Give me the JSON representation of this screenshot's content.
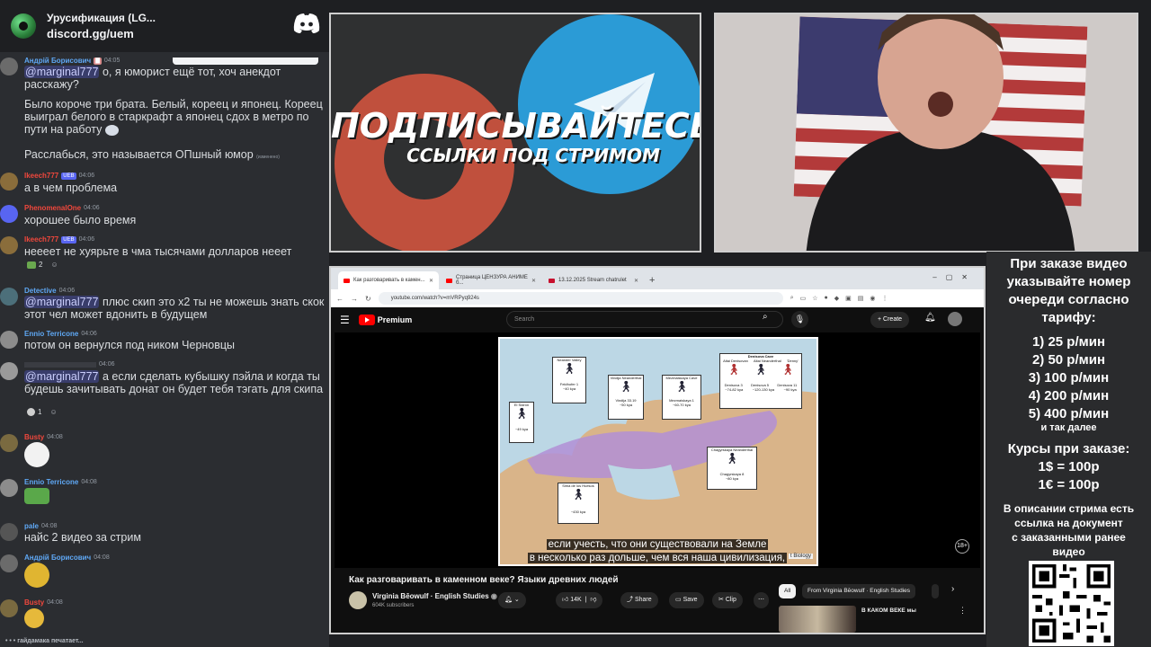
{
  "chat": {
    "server_name": "Урусификация (LG...",
    "invite": "discord.gg/uem",
    "typing": "гайдамака печатает...",
    "messages": [
      {
        "user": "Андрій Борисович",
        "user_color": "#5fa8f5",
        "time": "04:05",
        "mention": "@marginal777",
        "text": "о, я юморист ещё тот, хоч анекдот расскажу?"
      },
      {
        "user": "",
        "text": "Было короче три брата. Белый, кореец и японец. Кореец выиграл белого в старкрафт а японец сдох в метро по пути на работу"
      },
      {
        "user": "",
        "text": "Расслабься, это называется ОПшный юмор",
        "edited": "(изменено)"
      },
      {
        "user": "Ikeech777",
        "user_color": "#f0473c",
        "time": "04:06",
        "badge": "UEB",
        "text": "а в чем проблема"
      },
      {
        "user": "PhenomenalOne",
        "user_color": "#f0473c",
        "time": "04:06",
        "text": "хорошее было время"
      },
      {
        "user": "Ikeech777",
        "user_color": "#f0473c",
        "time": "04:06",
        "badge": "UEB",
        "text": "нееeeт не хуярьте в чма тысячами долларов нееет",
        "reaction_count": "2"
      },
      {
        "user": "Detective",
        "user_color": "#5fa8f5",
        "time": "04:06",
        "mention": "@marginal777",
        "text": "плюс скип это x2 ты не можешь знать скок этот чел может вдонить в будущем"
      },
      {
        "user": "Ennio Terricone",
        "user_color": "#5fa8f5",
        "time": "04:06",
        "text": "потом он вернулся под ником Черновцы"
      },
      {
        "user": "",
        "time": "04:06",
        "mention": "@marginal777",
        "text": "а если сделать кубышку пэйла и когда ты будешь зачитывать донат он будет тебя тэгать для скипа",
        "reaction_count": "1"
      },
      {
        "user": "Busty",
        "user_color": "#f0473c",
        "time": "04:08"
      },
      {
        "user": "Ennio Terricone",
        "user_color": "#5fa8f5",
        "time": "04:08"
      },
      {
        "user": "pale",
        "user_color": "#5fa8f5",
        "time": "04:08",
        "text": "найс 2 видео за стрим"
      },
      {
        "user": "Андрій Борисович",
        "user_color": "#5fa8f5",
        "time": "04:08"
      },
      {
        "user": "Busty",
        "user_color": "#f0473c",
        "time": "04:08"
      }
    ]
  },
  "promo": {
    "title": "ПОДПИСЫВАЙТЕСЬ",
    "subtitle": "ССЫЛКИ ПОД СТРИМОМ"
  },
  "browser": {
    "tabs": [
      "Как разговаривать в камен...",
      "Страница ЦЕНЗУРА АНИМЕ б...",
      "13.12.2025 Stream chatrulet"
    ],
    "url": "youtube.com/watch?v=mVRPyq924s",
    "youtube": {
      "brand": "Premium",
      "search_placeholder": "Search",
      "create_label": "Create",
      "subtitle_line1": "если учесть, что они существовали на Земле",
      "subtitle_line2": "в несколько раз дольше, чем вся наша цивилизация,",
      "age_badge": "18+",
      "source_label": "t Biology",
      "video_title": "Как разговаривать в каменном веке? Языки древних людей",
      "channel_name": "Virginia Bēowulf · English Studies",
      "channel_subs": "604K subscribers",
      "likes": "14K",
      "share": "Share",
      "save": "Save",
      "clip": "Clip",
      "chip_all": "All",
      "chip_from": "From Virginia Bēowulf · English Studies",
      "rec_title": "В КАКОМ ВЕКЕ мы"
    },
    "map_labels": {
      "neander": "Neander Valley",
      "feldhofer": "Feldhofer 1",
      "feldhofer_kya": "~40 kya",
      "vindija": "Vindija Neanderthal",
      "vindija_sub": "Vindija 33.19",
      "vindija_kya": "~50 kya",
      "mez": "Mezmaiskaya Cave",
      "mez_sub": "Mezmaiskaya 1",
      "mez_kya": "~60-70 kya",
      "deni": "Denisova Cave",
      "deni_a": "Altai Denisovan",
      "deni_b": "Altai Neanderthal",
      "deni_c": "'Denny'",
      "deni_1": "Denisova 3",
      "deni_2": "Denisova 5",
      "deni_3": "Denisova 11",
      "deni_1k": "~74-82 kya",
      "deni_2k": "~120-130 kya",
      "deni_3k": "~90 kya",
      "sidron": "El Sidrón",
      "sidron_kya": "~49 kya",
      "sima": "Sima de los Huesos",
      "sima_kya": "~430 kya",
      "chag": "Chagyrskaya Neanderthal",
      "chag_sub": "Chagyrskaya 8",
      "chag_kya": "~80 kya"
    }
  },
  "prices": {
    "intro": [
      "При заказе видео",
      "указывайте номер",
      "очереди согласно",
      "тарифу:"
    ],
    "tiers": [
      "1) 25 р/мин",
      "2) 50 р/мин",
      "3) 100 р/мин",
      "4) 200 р/мин",
      "5) 400 р/мин"
    ],
    "and_more": "и так далее",
    "rates_title": "Курсы при заказе:",
    "rates": [
      "1$ = 100р",
      "1€ = 100р"
    ],
    "footer": [
      "В описании стрима есть",
      "ссылка на документ",
      "с заказанными ранее",
      "видео"
    ]
  },
  "colors": {
    "discord_bg": "#2b2d31",
    "telegram_blue": "#2b9bd6",
    "promo_red": "#c0503d",
    "youtube_red": "#ff0000"
  }
}
